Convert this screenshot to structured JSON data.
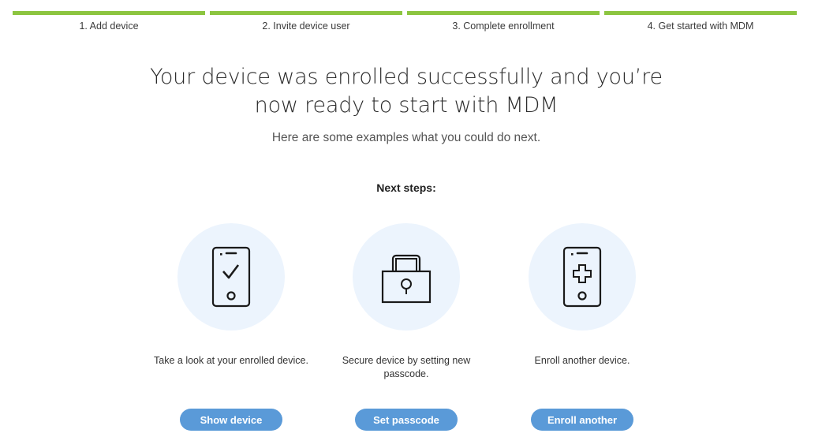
{
  "stepper": {
    "steps": [
      {
        "label": "1. Add device",
        "complete": true
      },
      {
        "label": "2. Invite device user",
        "complete": true
      },
      {
        "label": "3. Complete enrollment",
        "complete": true
      },
      {
        "label": "4. Get started with MDM",
        "complete": true
      }
    ],
    "color": "#8cc540"
  },
  "heading": {
    "line1": "Your device was enrolled successfully and you’re",
    "line2": "now ready to start with MDM",
    "subtitle": "Here are some examples what you could do next."
  },
  "next_steps_label": "Next steps:",
  "cards": [
    {
      "icon": "phone-check-icon",
      "text": "Take a look at your enrolled device.",
      "button": "Show device"
    },
    {
      "icon": "padlock-icon",
      "text": "Secure device by setting new passcode.",
      "button": "Set passcode"
    },
    {
      "icon": "phone-plus-icon",
      "text": "Enroll another device.",
      "button": "Enroll another"
    }
  ],
  "colors": {
    "accent_button": "#5a9ad8",
    "icon_circle": "#ecf4fd"
  }
}
